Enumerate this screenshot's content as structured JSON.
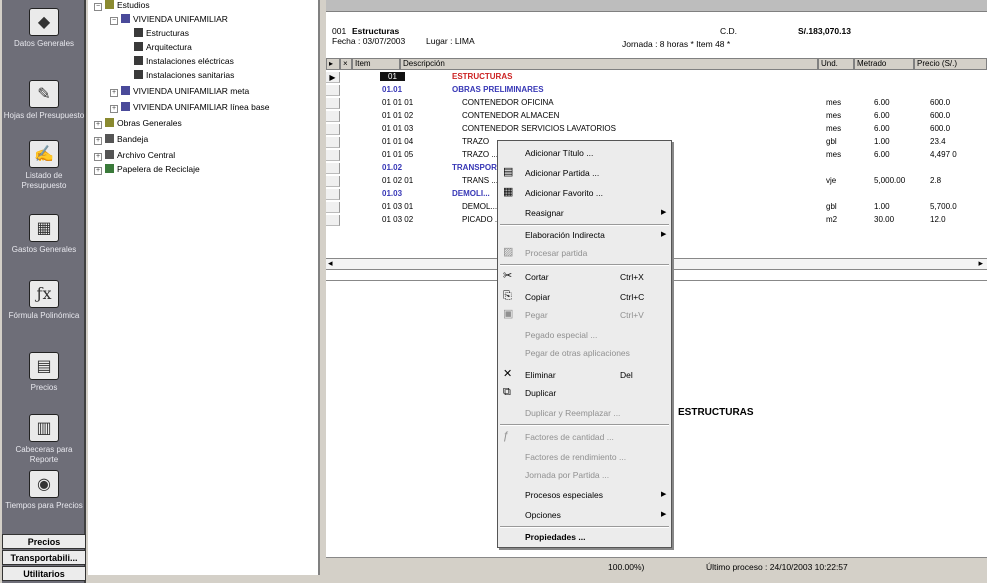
{
  "leftbar": {
    "items": [
      {
        "label": "Datos Generales",
        "icon": "◆"
      },
      {
        "label": "Hojas del Presupuesto",
        "icon": "✎"
      },
      {
        "label": "Listado de Presupuesto",
        "icon": "✍"
      },
      {
        "label": "Gastos Generales",
        "icon": "▦"
      },
      {
        "label": "Fórmula Polinómica",
        "icon": "ƒx"
      },
      {
        "label": "Precios",
        "icon": "▤"
      },
      {
        "label": "Cabeceras para Reporte",
        "icon": "▥"
      },
      {
        "label": "Tiempos para Precios",
        "icon": "◉"
      }
    ],
    "bottom": [
      "Precios",
      "Transportabili...",
      "Utilitarios"
    ]
  },
  "tree": {
    "items": [
      {
        "label": "Estudios",
        "level": 1,
        "icon": "folder"
      },
      {
        "label": "VIVIENDA UNIFAMILIAR",
        "level": 2,
        "icon": "house"
      },
      {
        "label": "Estructuras",
        "level": 3,
        "icon": "doc"
      },
      {
        "label": "Arquitectura",
        "level": 3,
        "icon": "doc"
      },
      {
        "label": "Instalaciones eléctricas",
        "level": 3,
        "icon": "doc"
      },
      {
        "label": "Instalaciones sanitarias",
        "level": 3,
        "icon": "doc"
      },
      {
        "label": "VIVIENDA UNIFAMILIAR meta",
        "level": 2,
        "icon": "house"
      },
      {
        "label": "VIVIENDA UNIFAMILIAR línea base",
        "level": 2,
        "icon": "house"
      },
      {
        "label": "Obras Generales",
        "level": 1,
        "icon": "folder"
      },
      {
        "label": "Bandeja",
        "level": 1,
        "icon": "tray"
      },
      {
        "label": "Archivo Central",
        "level": 1,
        "icon": "archive"
      },
      {
        "label": "Papelera de Reciclaje",
        "level": 1,
        "icon": "recycle"
      }
    ]
  },
  "header": {
    "code": "001",
    "name": "Estructuras",
    "fecha": "Fecha : 03/07/2003",
    "lugar": "Lugar : LIMA",
    "cd_label": "C.D.",
    "cd_value": "S/.183,070.13",
    "jornada": "Jornada : 8  horas   * Item 48 *"
  },
  "grid": {
    "columns": [
      "Item",
      "Descripción",
      "Und.",
      "Metrado",
      "Precio (S/.)"
    ],
    "rows": [
      {
        "item": "01",
        "desc": "ESTRUCTURAS",
        "und": "",
        "met": "",
        "pre": "",
        "style": "l0"
      },
      {
        "item": "01.01",
        "desc": "OBRAS PRELIMINARES",
        "und": "",
        "met": "",
        "pre": "",
        "style": "l1"
      },
      {
        "item": "01 01 01",
        "desc": "CONTENEDOR OFICINA",
        "und": "mes",
        "met": "6.00",
        "pre": "600.0",
        "style": "l2"
      },
      {
        "item": "01 01 02",
        "desc": "CONTENEDOR ALMACEN",
        "und": "mes",
        "met": "6.00",
        "pre": "600.0",
        "style": "l2"
      },
      {
        "item": "01 01 03",
        "desc": "CONTENEDOR SERVICIOS LAVATORIOS",
        "und": "mes",
        "met": "6.00",
        "pre": "600.0",
        "style": "l2"
      },
      {
        "item": "01 01 04",
        "desc": "TRAZO",
        "und": "gbl",
        "met": "1.00",
        "pre": "23.4",
        "style": "l2"
      },
      {
        "item": "01 01 05",
        "desc": "TRAZO ... A",
        "und": "mes",
        "met": "6.00",
        "pre": "4,497 0",
        "style": "l2"
      },
      {
        "item": "01.02",
        "desc": "TRANSPORTE ... DE MATERIALES",
        "und": "",
        "met": "",
        "pre": "",
        "style": "l1"
      },
      {
        "item": "01 02 01",
        "desc": "TRANS ... MATERIALES EN OBRA",
        "und": "vje",
        "met": "5,000.00",
        "pre": "2.8",
        "style": "l2"
      },
      {
        "item": "01.03",
        "desc": "DEMOLI...",
        "und": "",
        "met": "",
        "pre": "",
        "style": "l1"
      },
      {
        "item": "01 03 01",
        "desc": "DEMOL...",
        "und": "gbl",
        "met": "1.00",
        "pre": "5,700.0",
        "style": "l2"
      },
      {
        "item": "01 03 02",
        "desc": "PICADO ... RECIMIENTOS DE CONSTRUCCIO",
        "und": "m2",
        "met": "30.00",
        "pre": "12.0",
        "style": "l2"
      }
    ]
  },
  "lower_title": "ESTRUCTURAS",
  "status": {
    "zoom": "100.00%)",
    "last": "Último proceso : 24/10/2003 10:22:57"
  },
  "menu": {
    "items": [
      {
        "label": "Adicionar Título ...",
        "shortcut": "",
        "arrow": false,
        "disabled": false,
        "bold": false,
        "icon": ""
      },
      {
        "label": "Adicionar Partida ...",
        "shortcut": "",
        "arrow": false,
        "disabled": false,
        "bold": false,
        "icon": "▤"
      },
      {
        "label": "Adicionar Favorito ...",
        "shortcut": "",
        "arrow": false,
        "disabled": false,
        "bold": false,
        "icon": "▦"
      },
      {
        "label": "Reasignar",
        "shortcut": "",
        "arrow": true,
        "disabled": false,
        "bold": false,
        "icon": ""
      },
      {
        "label": "Elaboración Indirecta",
        "shortcut": "",
        "arrow": true,
        "disabled": false,
        "bold": false,
        "icon": ""
      },
      {
        "label": "Procesar partida",
        "shortcut": "",
        "arrow": false,
        "disabled": true,
        "bold": false,
        "icon": "▨"
      },
      {
        "label": "Cortar",
        "shortcut": "Ctrl+X",
        "arrow": false,
        "disabled": false,
        "bold": false,
        "icon": "✂"
      },
      {
        "label": "Copiar",
        "shortcut": "Ctrl+C",
        "arrow": false,
        "disabled": false,
        "bold": false,
        "icon": "⎘"
      },
      {
        "label": "Pegar",
        "shortcut": "Ctrl+V",
        "arrow": false,
        "disabled": true,
        "bold": false,
        "icon": "▣"
      },
      {
        "label": "Pegado especial ...",
        "shortcut": "",
        "arrow": false,
        "disabled": true,
        "bold": false,
        "icon": ""
      },
      {
        "label": "Pegar de otras aplicaciones",
        "shortcut": "",
        "arrow": false,
        "disabled": true,
        "bold": false,
        "icon": ""
      },
      {
        "label": "Eliminar",
        "shortcut": "Del",
        "arrow": false,
        "disabled": false,
        "bold": false,
        "icon": "✕"
      },
      {
        "label": "Duplicar",
        "shortcut": "",
        "arrow": false,
        "disabled": false,
        "bold": false,
        "icon": "⧉"
      },
      {
        "label": "Duplicar y Reemplazar ...",
        "shortcut": "",
        "arrow": false,
        "disabled": true,
        "bold": false,
        "icon": ""
      },
      {
        "label": "Factores de cantidad ...",
        "shortcut": "",
        "arrow": false,
        "disabled": true,
        "bold": false,
        "icon": "ƒ"
      },
      {
        "label": "Factores de rendimiento ...",
        "shortcut": "",
        "arrow": false,
        "disabled": true,
        "bold": false,
        "icon": ""
      },
      {
        "label": "Jornada por Partida ...",
        "shortcut": "",
        "arrow": false,
        "disabled": true,
        "bold": false,
        "icon": ""
      },
      {
        "label": "Procesos especiales",
        "shortcut": "",
        "arrow": true,
        "disabled": false,
        "bold": false,
        "icon": ""
      },
      {
        "label": "Opciones",
        "shortcut": "",
        "arrow": true,
        "disabled": false,
        "bold": false,
        "icon": ""
      },
      {
        "label": "Propiedades ...",
        "shortcut": "",
        "arrow": false,
        "disabled": false,
        "bold": true,
        "icon": ""
      }
    ]
  }
}
